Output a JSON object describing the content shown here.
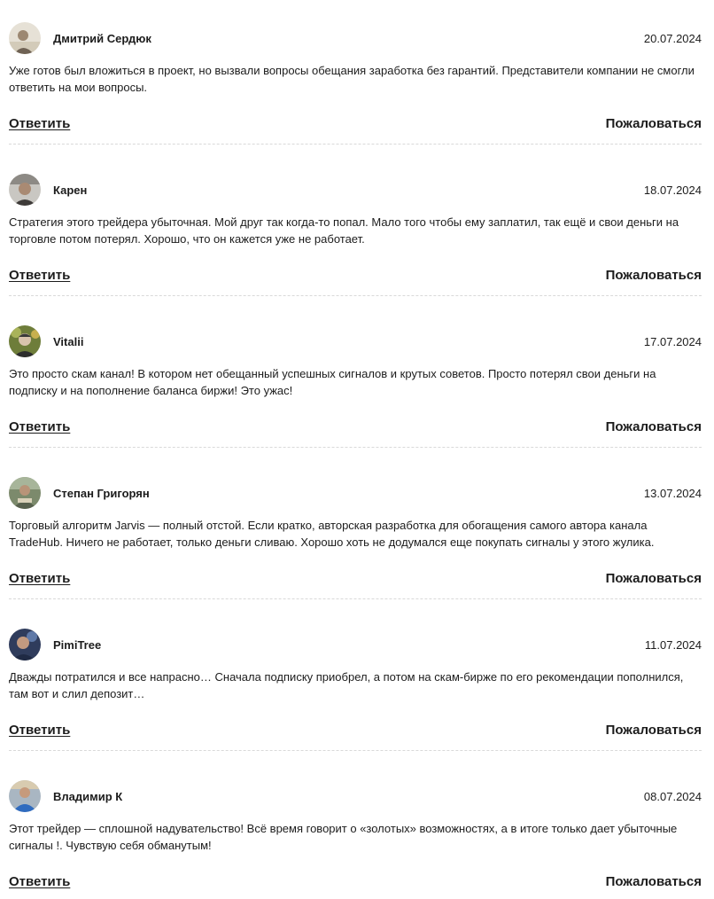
{
  "comments": [
    {
      "author": "Дмитрий Сердюк",
      "date": "20.07.2024",
      "text": "Уже готов был вложиться в проект, но вызвали вопросы обещания заработка без гарантий. Представители компании не смогли ответить на мои вопросы.",
      "reply_label": "Ответить",
      "report_label": "Пожаловаться"
    },
    {
      "author": "Карен",
      "date": "18.07.2024",
      "text": "Стратегия этого трейдера убыточная. Мой друг так когда-то попал. Мало того чтобы ему заплатил, так ещё и свои деньги на торговле потом потерял. Хорошо, что он кажется уже не работает.",
      "reply_label": "Ответить",
      "report_label": "Пожаловаться"
    },
    {
      "author": "Vitalii",
      "date": "17.07.2024",
      "text": "Это просто скам канал! В котором нет обещанный успешных сигналов и крутых советов. Просто потерял свои деньги на подписку и на пополнение баланса биржи! Это ужас!",
      "reply_label": "Ответить",
      "report_label": "Пожаловаться"
    },
    {
      "author": "Степан Григорян",
      "date": "13.07.2024",
      "text": "Торговый алгоритм Jarvis — полный отстой. Если кратко, авторская разработка для обогащения самого автора канала TradeHub. Ничего не работает, только деньги сливаю. Хорошо хоть не додумался еще покупать сигналы у этого жулика.",
      "reply_label": "Ответить",
      "report_label": "Пожаловаться"
    },
    {
      "author": "PimiTree",
      "date": "11.07.2024",
      "text": "Дважды потратился и все напрасно… Сначала подписку приобрел, а потом на скам-бирже по его рекомендации пополнился, там вот и слил депозит…",
      "reply_label": "Ответить",
      "report_label": "Пожаловаться"
    },
    {
      "author": "Владимир К",
      "date": "08.07.2024",
      "text": "Этот трейдер — сплошной надувательство! Всё время говорит о «золотых» возможностях, а в итоге только дает убыточные сигналы !. Чувствую себя обманутым!",
      "reply_label": "Ответить",
      "report_label": "Пожаловаться"
    }
  ]
}
